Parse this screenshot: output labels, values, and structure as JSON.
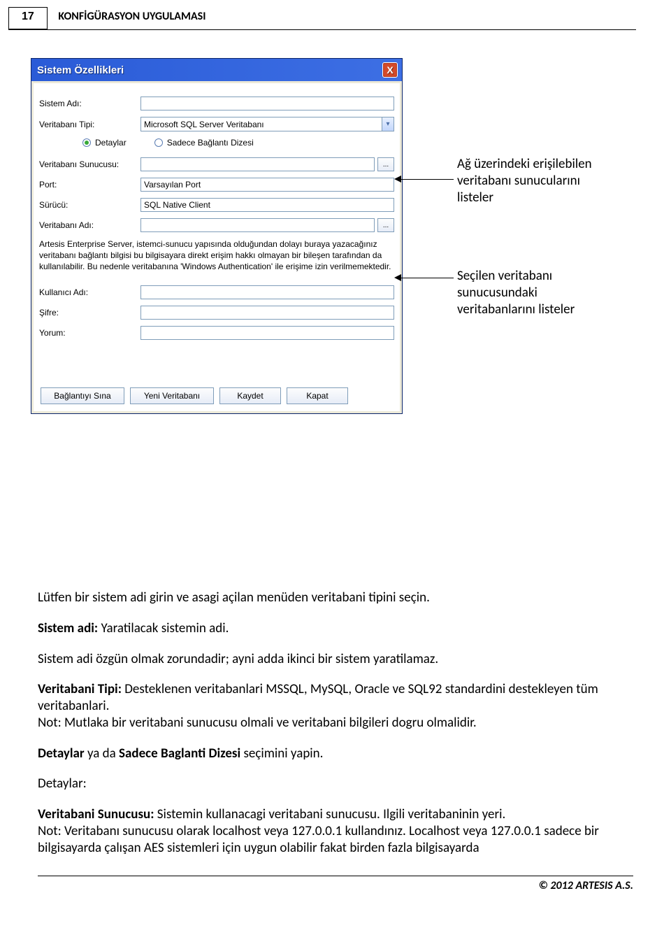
{
  "header": {
    "page_number": "17",
    "title": "KONFİGÜRASYON UYGULAMASI"
  },
  "dialog": {
    "title": "Sistem Özellikleri",
    "close": "X",
    "labels": {
      "sistem_adi": "Sistem Adı:",
      "veritabani_tipi": "Veritabanı Tipi:",
      "detaylar": "Detaylar",
      "sadece_baglanti": "Sadece Bağlantı Dizesi",
      "veritabani_sunucusu": "Veritabanı Sunucusu:",
      "port": "Port:",
      "surucu": "Sürücü:",
      "veritabani_adi": "Veritabanı Adı:",
      "kullanici_adi": "Kullanıcı Adı:",
      "sifre": "Şifre:",
      "yorum": "Yorum:"
    },
    "values": {
      "veritabani_tipi": "Microsoft SQL Server Veritabanı",
      "port": "Varsayılan Port",
      "surucu": "SQL Native Client"
    },
    "info_text": "Artesis Enterprise Server, istemci-sunucu yapısında olduğundan dolayı buraya yazacağınız veritabanı bağlantı bilgisi bu bilgisayara direkt erişim hakkı olmayan bir bileşen tarafından da kullanılabilir.\nBu nedenle veritabanına 'Windows Authentication' ile erişime izin verilmemektedir.",
    "buttons": {
      "baglanti_sina": "Bağlantıyı Sına",
      "yeni_veritabani": "Yeni Veritabanı",
      "kaydet": "Kaydet",
      "kapat": "Kapat",
      "browse": "..."
    }
  },
  "annotations": {
    "top": "Ağ üzerindeki erişilebilen veritabanı sunucularını listeler",
    "bottom": "Seçilen veritabanı sunucusundaki veritabanlarını listeler"
  },
  "body": {
    "p1": "Lütfen bir sistem adi girin ve asagi açilan menüden veritabani tipini seçin.",
    "p2_a": "Sistem adi:",
    "p2_b": " Yaratilacak sistemin adi.",
    "p3": "Sistem adi özgün olmak zorundadir; ayni adda ikinci bir sistem yaratilamaz.",
    "p4_a": "Veritabani Tipi:",
    "p4_b": " Desteklenen veritabanlari MSSQL, MySQL, Oracle ve SQL92 standardini destekleyen tüm veritabanlari.",
    "p5": "Not: Mutlaka bir veritabani sunucusu olmali ve veritabani bilgileri dogru olmalidir.",
    "p6_a": "Detaylar",
    "p6_b": " ya da ",
    "p6_c": "Sadece Baglanti Dizesi",
    "p6_d": " seçimini yapin.",
    "p7": "Detaylar:",
    "p8_a": "Veritabani Sunucusu:",
    "p8_b": " Sistemin kullanacagi veritabani sunucusu. Ilgili veritabaninin yeri.",
    "p9": "Not: Veritabanı sunucusu olarak localhost veya 127.0.0.1 kullandınız. Localhost veya 127.0.0.1 sadece bir bilgisayarda çalışan AES sistemleri için uygun olabilir fakat birden fazla bilgisayarda"
  },
  "footer": "© 2012 ARTESIS A.S."
}
